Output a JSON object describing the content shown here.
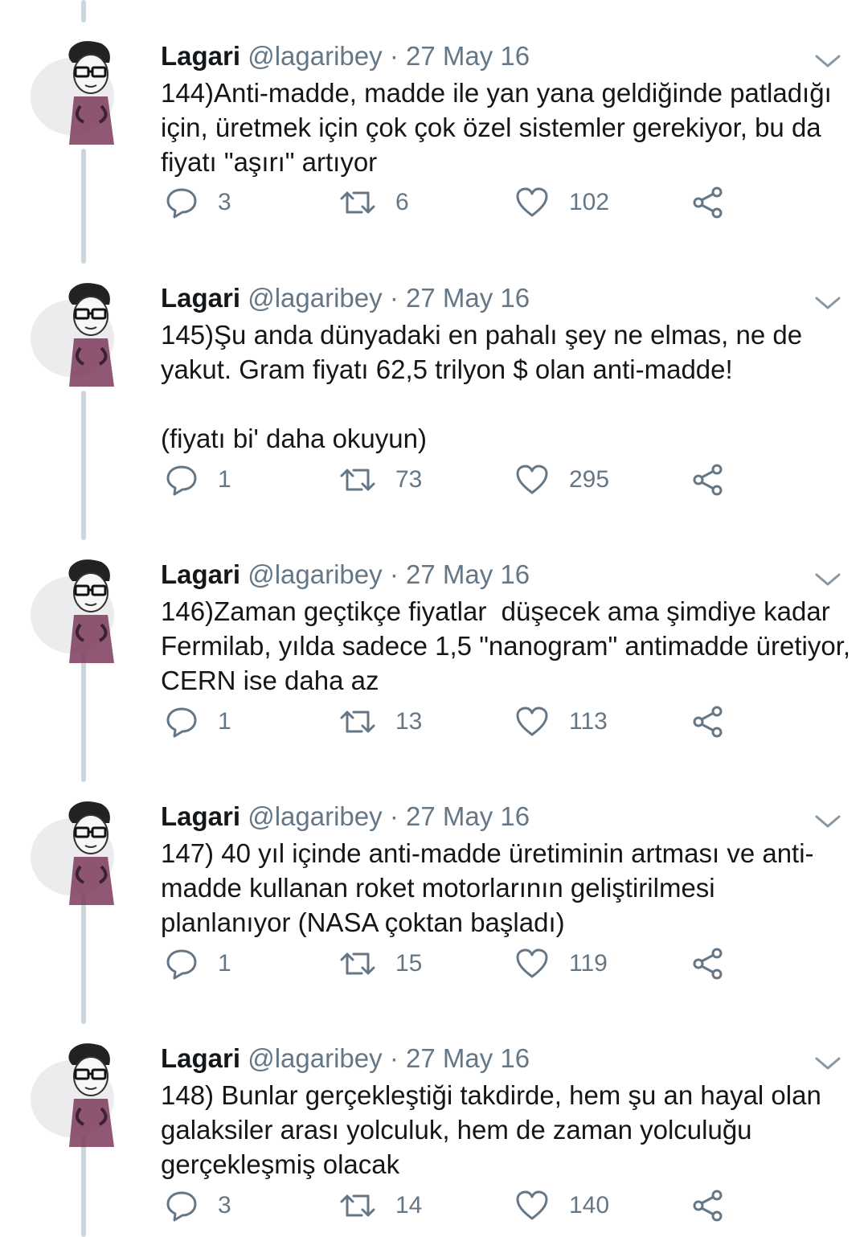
{
  "colors": {
    "text": "#14171a",
    "muted": "#657786",
    "thread_line": "#ccd6dd"
  },
  "tweets": [
    {
      "name": "Lagari",
      "handle": "@lagaribey",
      "dot": "·",
      "time": "27 May 16",
      "text": "144)Anti-madde, madde ile yan yana geldiğinde patladığı için, üretmek için çok çok özel sistemler gerekiyor, bu da fiyatı \"aşırı\" artıyor",
      "replies": "3",
      "retweets": "6",
      "likes": "102"
    },
    {
      "name": "Lagari",
      "handle": "@lagaribey",
      "dot": "·",
      "time": "27 May 16",
      "text": "145)Şu anda dünyadaki en pahalı şey ne elmas, ne de yakut. Gram fiyatı 62,5 trilyon $ olan anti-madde!\n\n(fiyatı bi' daha okuyun)",
      "replies": "1",
      "retweets": "73",
      "likes": "295"
    },
    {
      "name": "Lagari",
      "handle": "@lagaribey",
      "dot": "·",
      "time": "27 May 16",
      "text": "146)Zaman geçtikçe fiyatlar  düşecek ama şimdiye kadar Fermilab, yılda sadece 1,5 \"nanogram\" antimadde üretiyor, CERN ise daha az",
      "replies": "1",
      "retweets": "13",
      "likes": "113"
    },
    {
      "name": "Lagari",
      "handle": "@lagaribey",
      "dot": "·",
      "time": "27 May 16",
      "text": "147) 40 yıl içinde anti-madde üretiminin artması ve anti-madde kullanan roket motorlarının geliştirilmesi planlanıyor (NASA çoktan başladı)",
      "replies": "1",
      "retweets": "15",
      "likes": "119"
    },
    {
      "name": "Lagari",
      "handle": "@lagaribey",
      "dot": "·",
      "time": "27 May 16",
      "text": "148) Bunlar gerçekleştiği takdirde, hem şu an hayal olan galaksiler arası yolculuk, hem de zaman yolculuğu gerçekleşmiş olacak",
      "replies": "3",
      "retweets": "14",
      "likes": "140"
    }
  ]
}
